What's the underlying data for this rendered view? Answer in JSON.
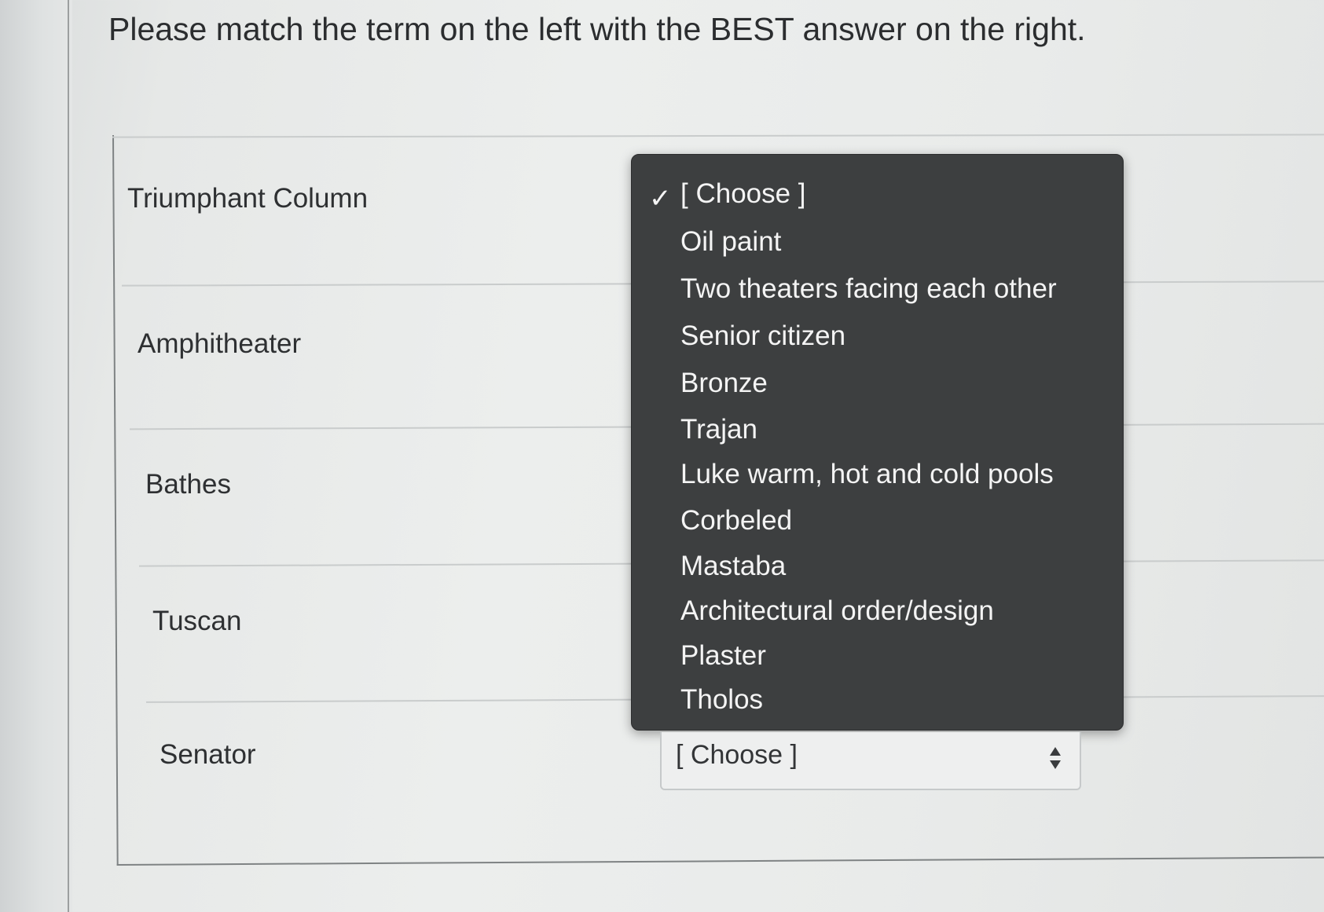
{
  "question": "Please match the term on the left with the BEST answer on the right.",
  "terms": [
    "Triumphant Column",
    "Amphitheater",
    "Bathes",
    "Tuscan",
    "Senator"
  ],
  "dropdown": {
    "selected_marker": "✓",
    "options": [
      "[ Choose ]",
      "Oil paint",
      "Two theaters facing each other",
      "Senior citizen",
      "Bronze",
      "Trajan",
      "Luke warm, hot and cold pools",
      "Corbeled",
      "Mastaba",
      "Architectural order/design",
      "Plaster",
      "Tholos"
    ]
  },
  "select": {
    "value": "[ Choose ]",
    "icon": "up-down-arrows-icon"
  },
  "colors": {
    "menu_background": "#3d3f40",
    "menu_text": "#f4f4f4",
    "page_background": "#eceeed"
  }
}
